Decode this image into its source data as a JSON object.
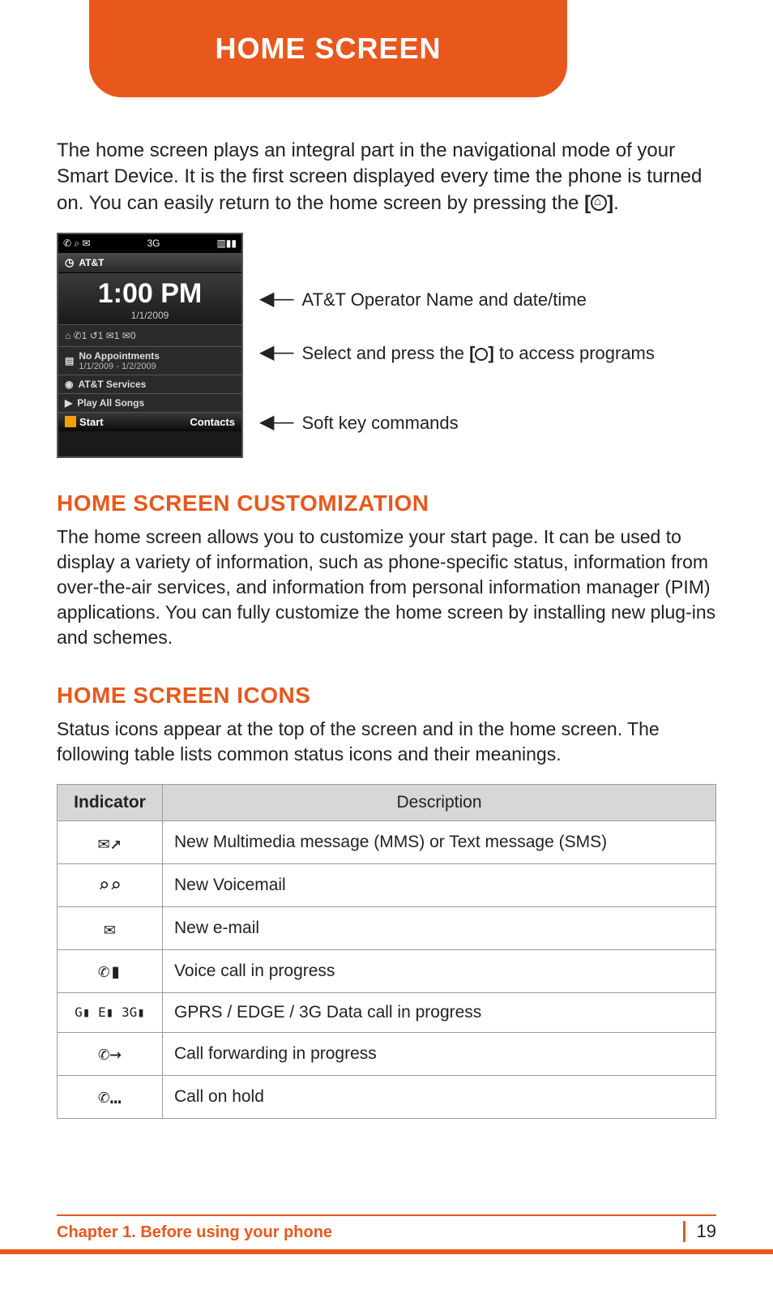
{
  "header": {
    "title": "HOME SCREEN"
  },
  "intro": {
    "text": "The home screen plays an integral part in the navigational mode of your Smart Device. It is the first screen displayed every time the phone is turned on. You can easily return to the home screen by pressing the ",
    "key_suffix": "."
  },
  "phone": {
    "status_left": "✆ ⌕ ✉",
    "status_net": "3G",
    "status_right": "▥▮▮",
    "operator": "AT&T",
    "time": "1:00 PM",
    "date": "1/1/2009",
    "counters": "⌂  ✆1  ↺1  ✉1  ✉0",
    "appt_title": "No Appointments",
    "appt_range": "1/1/2009 - 1/2/2009",
    "services": "AT&T Services",
    "songs": "Play All Songs",
    "softkey_left": "Start",
    "softkey_right": "Contacts"
  },
  "callouts": {
    "a": "AT&T Operator Name and date/time",
    "b_pre": "Select and press the ",
    "b_post": " to access programs",
    "c": "Soft key commands"
  },
  "sections": {
    "custom_title": "HOME SCREEN CUSTOMIZATION",
    "custom_body": "The home screen allows you to customize your start page. It can be used to display a variety of information, such as phone-specific status, information from over-the-air services, and information from personal information manager (PIM) applications. You can fully customize the home screen by installing new plug-ins and schemes.",
    "icons_title": "HOME SCREEN ICONS",
    "icons_body": "Status icons appear at the top of the screen and in the home screen. The following table lists common status icons and their meanings."
  },
  "table": {
    "head_indicator": "Indicator",
    "head_desc": "Description",
    "rows": [
      {
        "icon": "✉↗",
        "desc": "New Multimedia message (MMS) or Text message (SMS)"
      },
      {
        "icon": "⌕⌕",
        "desc": "New Voicemail"
      },
      {
        "icon": "✉",
        "desc": "New e-mail"
      },
      {
        "icon": "✆▮",
        "desc": "Voice call in progress"
      },
      {
        "icon": "G▮ E▮ 3G▮",
        "desc": "GPRS / EDGE / 3G Data call in progress"
      },
      {
        "icon": "✆→",
        "desc": "Call forwarding in progress"
      },
      {
        "icon": "✆…",
        "desc": "Call on hold"
      }
    ]
  },
  "footer": {
    "chapter": "Chapter 1. Before using your phone",
    "page": "19"
  }
}
